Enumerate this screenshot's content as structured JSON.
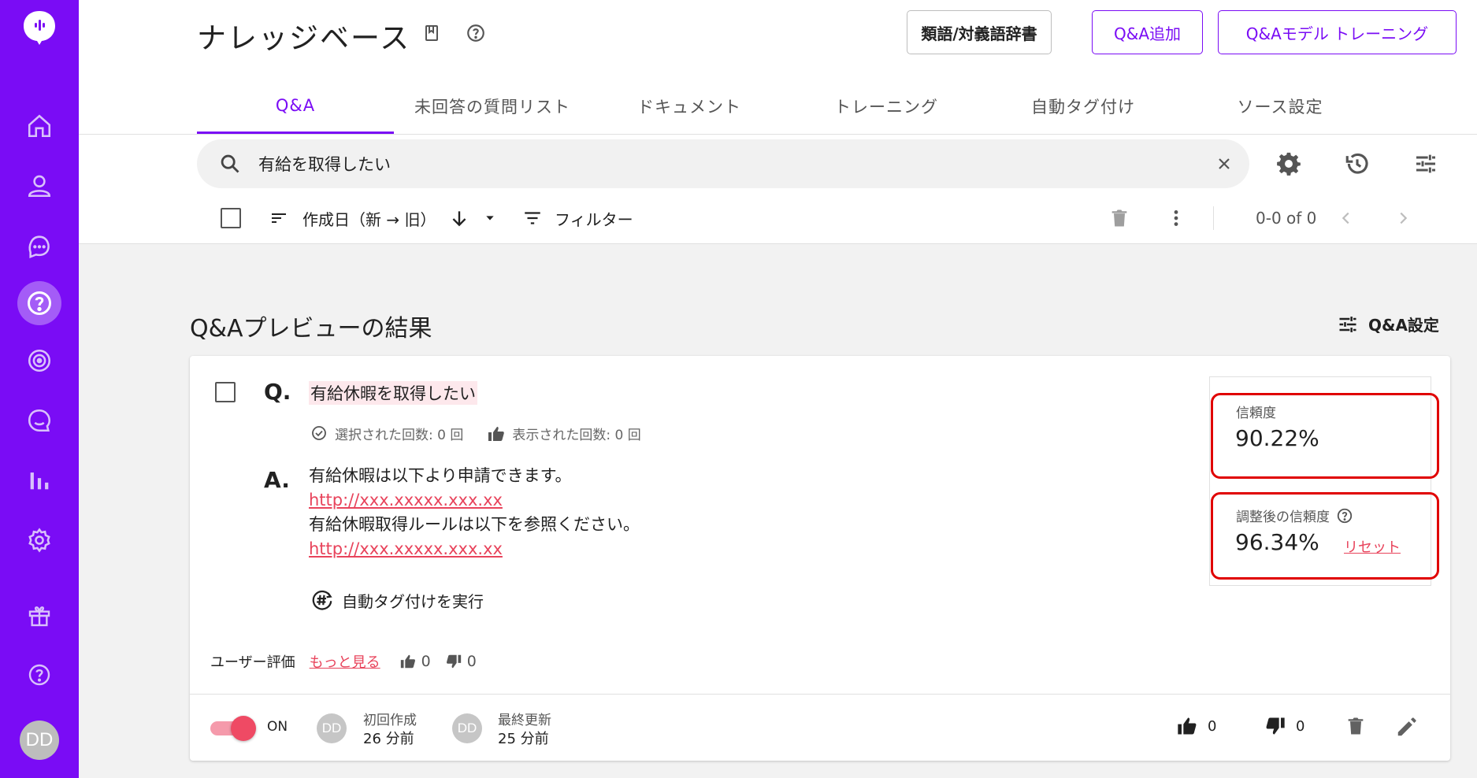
{
  "app": {
    "avatar_initials": "DD",
    "accent_color": "#7a0cf5"
  },
  "sidebar": {
    "items": [
      {
        "name": "home-icon"
      },
      {
        "name": "user-icon"
      },
      {
        "name": "chat-icon"
      },
      {
        "name": "qa-icon",
        "active": true
      },
      {
        "name": "target-icon"
      },
      {
        "name": "search-chat-icon"
      },
      {
        "name": "analytics-icon"
      },
      {
        "name": "settings-icon"
      },
      {
        "name": "gift-icon"
      },
      {
        "name": "help-icon"
      }
    ]
  },
  "header": {
    "title": "ナレッジベース",
    "buttons": {
      "dictionary": "類語/対義語辞書",
      "add_qa": "Q&A追加",
      "training": "Q&Aモデル トレーニング"
    }
  },
  "tabs": [
    {
      "label": "Q&A",
      "active": true
    },
    {
      "label": "未回答の質問リスト"
    },
    {
      "label": "ドキュメント"
    },
    {
      "label": "トレーニング"
    },
    {
      "label": "自動タグ付け"
    },
    {
      "label": "ソース設定"
    }
  ],
  "search": {
    "value": "有給を取得したい"
  },
  "toolbar": {
    "sort_label": "作成日（新 → 旧）",
    "filter_label": "フィルター",
    "pagination": "0-0 of 0"
  },
  "section": {
    "title": "Q&Aプレビューの結果",
    "settings_label": "Q&A設定"
  },
  "card": {
    "q_letter": "Q.",
    "question": "有給休暇を取得したい",
    "stats": {
      "selected": "選択された回数: 0 回",
      "shown": "表示された回数: 0 回"
    },
    "a_letter": "A.",
    "answer": {
      "line1": "有給休暇は以下より申請できます。",
      "link1": "http://xxx.xxxxx.xxx.xx",
      "line2": "有給休暇取得ルールは以下を参照ください。",
      "link2": "http://xxx.xxxxx.xxx.xx"
    },
    "auto_tag_label": "自動タグ付けを実行",
    "rating": {
      "label": "ユーザー評価",
      "more": "もっと見る",
      "likes": "0",
      "dislikes": "0"
    },
    "confidence": {
      "label": "信頼度",
      "value": "90.22%",
      "adjusted_label": "調整後の信頼度",
      "adjusted_value": "96.34%",
      "reset": "リセット"
    },
    "footer": {
      "toggle_label": "ON",
      "toggle_on": true,
      "created_label": "初回作成",
      "created_value": "26 分前",
      "updated_label": "最終更新",
      "updated_value": "25 分前",
      "avatar_initials": "DD",
      "likes": "0",
      "dislikes": "0"
    }
  }
}
